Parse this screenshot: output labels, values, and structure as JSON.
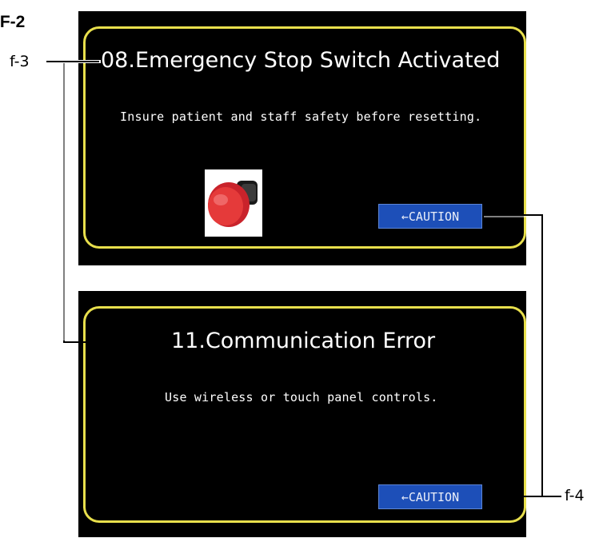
{
  "figure_label": ".F-2",
  "callouts": {
    "f3": "f-3",
    "f4": "f-4"
  },
  "screens": [
    {
      "title": "08.Emergency Stop Switch Activated",
      "message": "Insure patient and staff safety before resetting.",
      "button_label": "←CAUTION",
      "image_icon": "emergency-stop-button"
    },
    {
      "title": "11.Communication Error",
      "message": "Use wireless or touch panel controls.",
      "button_label": "←CAUTION"
    }
  ],
  "colors": {
    "panel_border": "#e8df4c",
    "button_bg": "#1d4fb8",
    "screen_bg": "#000000",
    "estop_red": "#e53a3a"
  }
}
